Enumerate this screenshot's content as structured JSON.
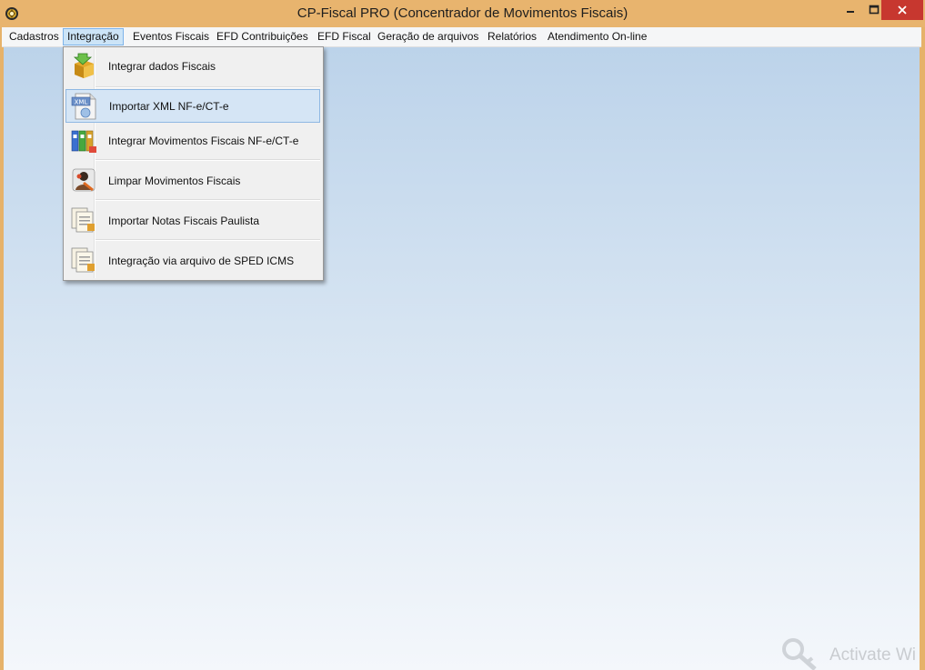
{
  "window": {
    "title": "CP-Fiscal PRO (Concentrador de Movimentos Fiscais)",
    "minimize_glyph": "–",
    "maximize_glyph": "□",
    "close_glyph": "✕"
  },
  "menubar": {
    "items": [
      {
        "label": "Cadastros"
      },
      {
        "label": "Integração",
        "active": true
      },
      {
        "label": "Eventos Fiscais"
      },
      {
        "label": "EFD Contribuições"
      },
      {
        "label": "EFD Fiscal"
      },
      {
        "label": "Geração de arquivos"
      },
      {
        "label": "Relatórios"
      },
      {
        "label": "Atendimento On-line"
      }
    ]
  },
  "integracao_menu": {
    "items": [
      {
        "label": "Integrar dados Fiscais",
        "icon": "box-arrow-icon"
      },
      {
        "label": "Importar XML NF-e/CT-e",
        "icon": "xml-file-icon",
        "highlighted": true
      },
      {
        "label": "Integrar Movimentos Fiscais NF-e/CT-e",
        "icon": "binders-icon"
      },
      {
        "label": "Limpar Movimentos Fiscais",
        "icon": "person-clear-icon"
      },
      {
        "label": "Importar Notas Fiscais Paulista",
        "icon": "documents-icon"
      },
      {
        "label": "Integração via arquivo de SPED ICMS",
        "icon": "documents-icon"
      }
    ]
  },
  "watermark": {
    "text": "Activate Wi"
  },
  "colors": {
    "titlebar": "#e8b46e",
    "close_button": "#c7372f",
    "menu_highlight": "#cce4f7",
    "client_top": "#bcd3ea",
    "client_bottom": "#f4f7fb"
  }
}
